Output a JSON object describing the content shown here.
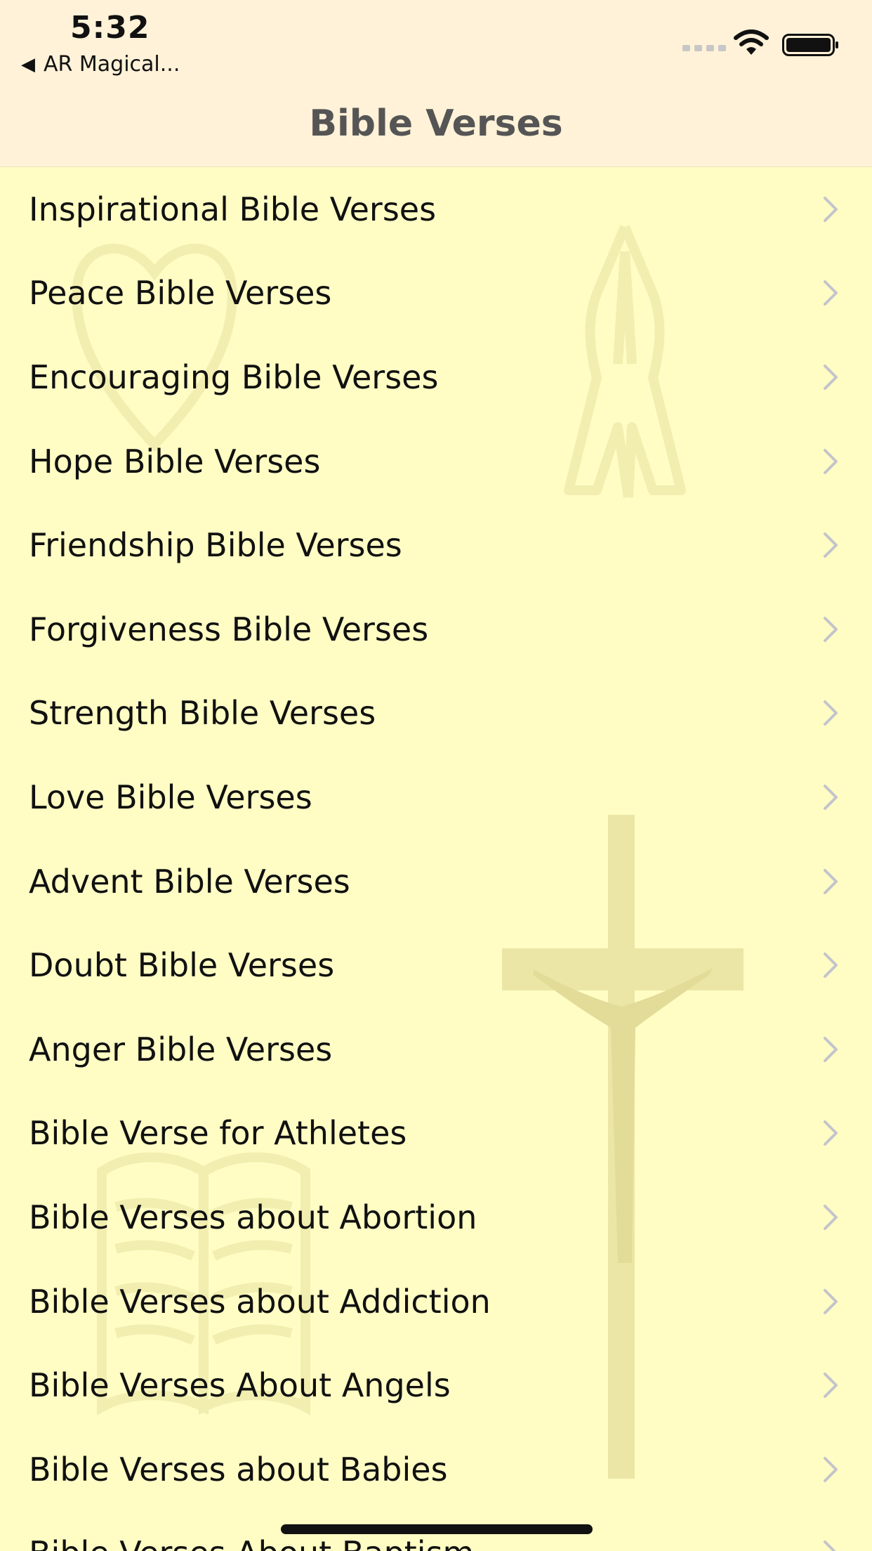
{
  "status": {
    "time": "5:32",
    "back_app": "AR Magical..."
  },
  "nav": {
    "title": "Bible Verses"
  },
  "icons": {
    "back_arrow": "back-triangle-icon",
    "chevron": "chevron-right-icon",
    "wifi": "wifi-icon",
    "battery": "battery-icon",
    "signal": "cellular-signal-icon"
  },
  "colors": {
    "background": "#fffdc4",
    "header": "#fff2d8",
    "chevron": "#c4c4cc",
    "title": "#555555"
  },
  "items": [
    {
      "label": "Inspirational Bible Verses"
    },
    {
      "label": "Peace Bible Verses"
    },
    {
      "label": "Encouraging Bible Verses"
    },
    {
      "label": "Hope Bible Verses"
    },
    {
      "label": "Friendship Bible Verses"
    },
    {
      "label": "Forgiveness Bible Verses"
    },
    {
      "label": "Strength Bible Verses"
    },
    {
      "label": "Love Bible Verses"
    },
    {
      "label": "Advent Bible Verses"
    },
    {
      "label": "Doubt Bible Verses"
    },
    {
      "label": "Anger Bible Verses"
    },
    {
      "label": "Bible Verse for Athletes"
    },
    {
      "label": "Bible Verses about Abortion"
    },
    {
      "label": "Bible Verses about Addiction"
    },
    {
      "label": "Bible Verses About Angels"
    },
    {
      "label": "Bible Verses about Babies"
    },
    {
      "label": "Bible Verses About Baptism"
    }
  ]
}
